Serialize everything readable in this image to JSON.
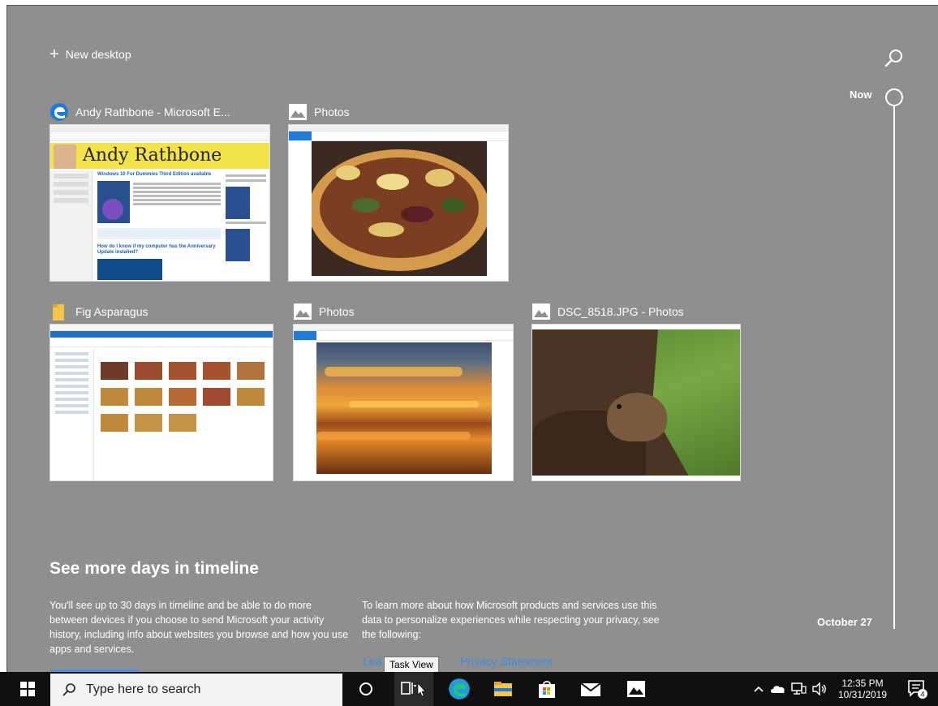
{
  "new_desktop": {
    "label": "New desktop"
  },
  "timeline": {
    "now_label": "Now",
    "date_label": "October 27"
  },
  "cards": [
    {
      "title": "Andy Rathbone - Microsoft E...",
      "app": "edge-icon"
    },
    {
      "title": "Photos",
      "app": "photos-icon"
    },
    {
      "title": "Fig Asparagus",
      "app": "folder-icon"
    },
    {
      "title": "Photos",
      "app": "photos-icon"
    },
    {
      "title": "DSC_8518.JPG - Photos",
      "app": "photos-icon"
    }
  ],
  "thumb_text": {
    "andy_banner": "Andy Rathbone",
    "andy_heading": "Windows 10 For Dummies Third Edition available",
    "andy_heading2": "How do I know if my computer has the Anniversary Update installed?"
  },
  "promo": {
    "title": "See more days in timeline",
    "text1": "You'll see up to 30 days in timeline and be able to do more between devices if you choose to send Microsoft your activity history, including info about websites you browse and how you use apps and services.",
    "text2": "To learn more about how Microsoft products and services use this data to personalize experiences while respecting your privacy, see the following:",
    "link1": "Lea",
    "link2": "Privacy Statement",
    "tooltip": "Task View"
  },
  "taskbar": {
    "search_placeholder": "Type here to search",
    "time": "12:35 PM",
    "date": "10/31/2019",
    "notification_count": "4",
    "icons": [
      "windows-start-icon",
      "cortana-icon",
      "task-view-icon",
      "edge-icon",
      "file-explorer-icon",
      "store-icon",
      "mail-icon",
      "photos-icon"
    ]
  },
  "colors": {
    "background": "#8f8f8f",
    "taskbar": "#101010",
    "accent": "#4a90e2"
  }
}
